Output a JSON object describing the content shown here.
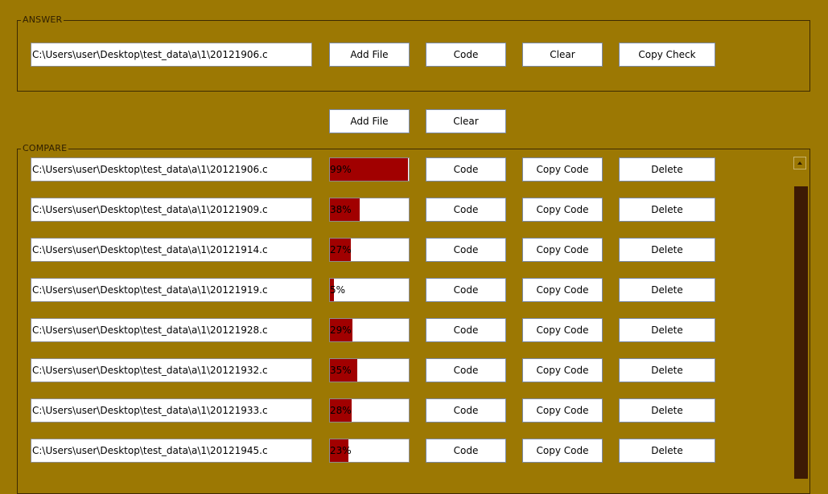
{
  "answer": {
    "legend": "ANSWER",
    "path": "C:\\Users\\user\\Desktop\\test_data\\a\\1\\20121906.c",
    "buttons": {
      "add_file": "Add File",
      "code": "Code",
      "clear": "Clear",
      "copy_check": "Copy Check"
    }
  },
  "middle_toolbar": {
    "add_file": "Add File",
    "clear": "Clear"
  },
  "compare": {
    "legend": "COMPARE",
    "row_buttons": {
      "code": "Code",
      "copy_code": "Copy Code",
      "delete": "Delete"
    },
    "rows": [
      {
        "path": "C:\\Users\\user\\Desktop\\test_data\\a\\1\\20121906.c",
        "percent_label": "99%",
        "percent": 99
      },
      {
        "path": "C:\\Users\\user\\Desktop\\test_data\\a\\1\\20121909.c",
        "percent_label": "38%",
        "percent": 38
      },
      {
        "path": "C:\\Users\\user\\Desktop\\test_data\\a\\1\\20121914.c",
        "percent_label": "27%",
        "percent": 27
      },
      {
        "path": "C:\\Users\\user\\Desktop\\test_data\\a\\1\\20121919.c",
        "percent_label": "5%",
        "percent": 5
      },
      {
        "path": "C:\\Users\\user\\Desktop\\test_data\\a\\1\\20121928.c",
        "percent_label": "29%",
        "percent": 29
      },
      {
        "path": "C:\\Users\\user\\Desktop\\test_data\\a\\1\\20121932.c",
        "percent_label": "35%",
        "percent": 35
      },
      {
        "path": "C:\\Users\\user\\Desktop\\test_data\\a\\1\\20121933.c",
        "percent_label": "28%",
        "percent": 28
      },
      {
        "path": "C:\\Users\\user\\Desktop\\test_data\\a\\1\\20121945.c",
        "percent_label": "23%",
        "percent": 23
      }
    ]
  },
  "icons": {
    "scroll_up": "chevron-up-icon"
  },
  "colors": {
    "background": "#9c7803",
    "progress_fill": "#a10000",
    "scroll_thumb": "#3d1a04",
    "group_border": "#3d2a02"
  }
}
